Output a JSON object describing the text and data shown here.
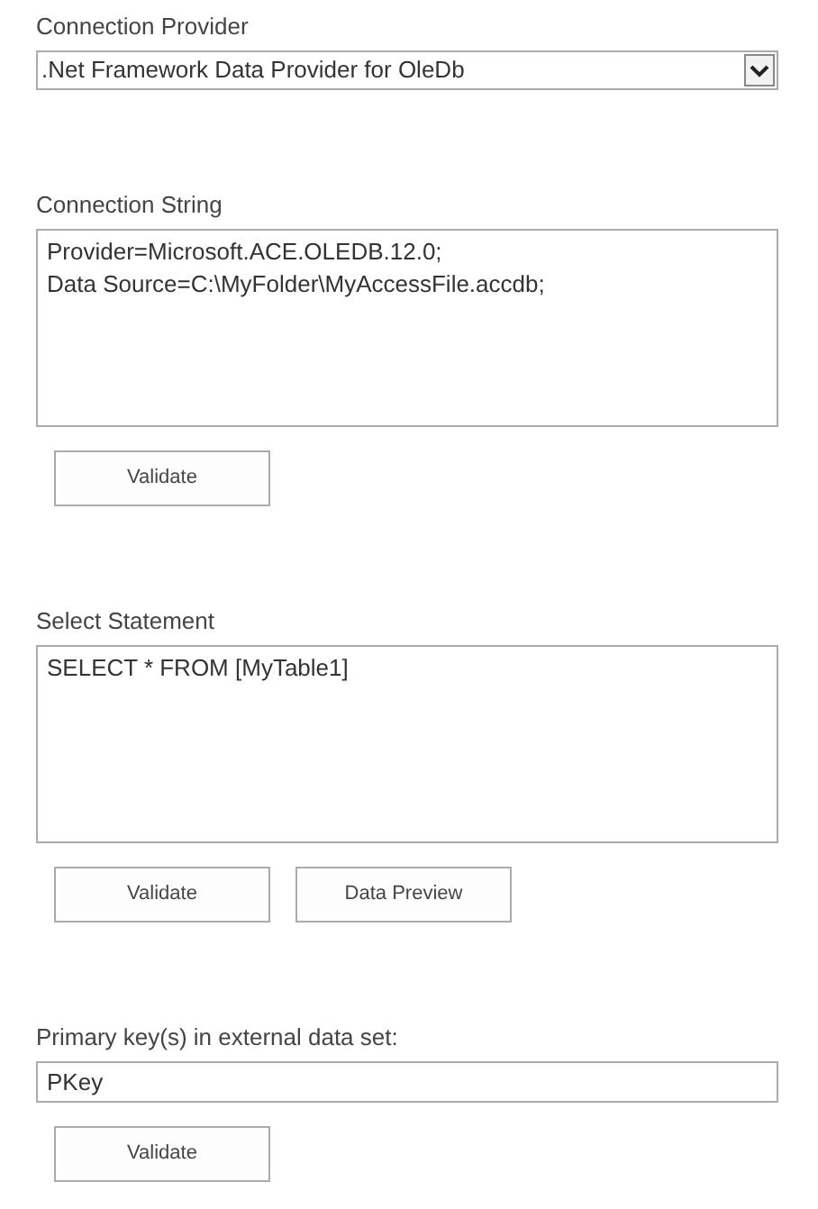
{
  "sections": [
    {
      "label": "Connection Provider",
      "kind": "dropdown",
      "value": ".Net Framework Data Provider for OleDb"
    },
    {
      "label": "Connection String",
      "kind": "textarea",
      "lines": [
        "Provider=Microsoft.ACE.OLEDB.12.0;",
        "Data Source=C:\\MyFolder\\MyAccessFile.accdb;"
      ],
      "buttons": [
        "Validate"
      ]
    },
    {
      "label": "Select Statement",
      "kind": "textarea",
      "lines": [
        "SELECT * FROM [MyTable1]"
      ],
      "buttons": [
        "Validate",
        "Data Preview"
      ]
    },
    {
      "label": "Primary key(s) in external data set:",
      "kind": "input",
      "value": "PKey",
      "buttons": [
        "Validate"
      ]
    }
  ]
}
